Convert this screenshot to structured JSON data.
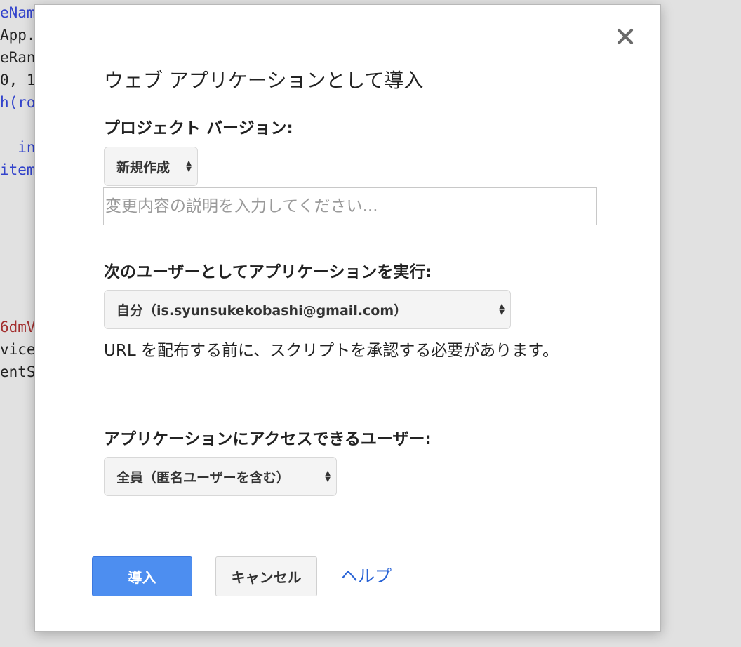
{
  "background_code": {
    "lines": [
      {
        "text": "eName",
        "color": "#3344cc"
      },
      {
        "text": "App.g",
        "color": "#222222"
      },
      {
        "text": "eRang",
        "color": "#222222"
      },
      {
        "text": "0, 1",
        "color": "#222222"
      },
      {
        "text": "h(row",
        "color": "#3344cc"
      },
      {
        "text": "",
        "color": "#222222"
      },
      {
        "text": "  ind",
        "color": "#3344cc"
      },
      {
        "text": "item",
        "color": "#3344cc"
      },
      {
        "text": "6dmV",
        "color": "#a32e2e"
      },
      {
        "text": "vice",
        "color": "#222222"
      },
      {
        "text": "entSe",
        "color": "#222222"
      }
    ]
  },
  "dialog": {
    "title": "ウェブ アプリケーションとして導入",
    "close_icon": "×",
    "project_version": {
      "label": "プロジェクト バージョン:",
      "selected": "新規作成"
    },
    "description_input": {
      "value": "",
      "placeholder": "変更内容の説明を入力してください..."
    },
    "execute_as": {
      "label": "次のユーザーとしてアプリケーションを実行:",
      "selected": "自分（is.syunsukekobashi@gmail.com）"
    },
    "authorization_note": "URL を配布する前に、スクリプトを承認する必要があります。",
    "access": {
      "label": "アプリケーションにアクセスできるユーザー:",
      "selected": "全員（匿名ユーザーを含む）"
    },
    "buttons": {
      "deploy": "導入",
      "cancel": "キャンセル",
      "help": "ヘルプ"
    }
  },
  "colors": {
    "primary_button": "#4d8ef0",
    "link": "#2a64d6"
  }
}
